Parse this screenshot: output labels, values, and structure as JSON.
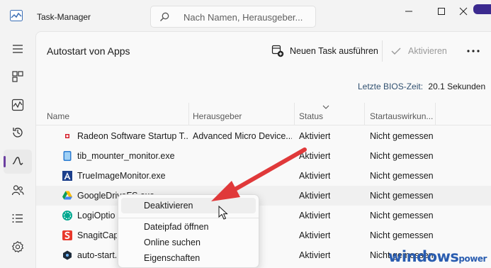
{
  "titlebar": {
    "title": "Task-Manager",
    "search_placeholder": "Nach Namen, Herausgeber..."
  },
  "nav": {
    "items": [
      {
        "icon": "hamburger-icon"
      },
      {
        "icon": "processes-icon"
      },
      {
        "icon": "performance-icon"
      },
      {
        "icon": "app-history-icon"
      },
      {
        "icon": "startup-apps-icon",
        "active": true
      },
      {
        "icon": "users-icon"
      },
      {
        "icon": "details-icon"
      },
      {
        "icon": "services-icon"
      }
    ]
  },
  "toolbar": {
    "page_title": "Autostart von Apps",
    "new_task_label": "Neuen Task ausführen",
    "disable_label": "Aktivieren"
  },
  "bios": {
    "label": "Letzte BIOS-Zeit:",
    "value": "20.1 Sekunden"
  },
  "table": {
    "columns": [
      "Name",
      "Herausgeber",
      "Status",
      "Startauswirkun..."
    ],
    "rows": [
      {
        "name": "Radeon Software Startup T...",
        "publisher": "Advanced Micro Device...",
        "status": "Aktiviert",
        "impact": "Nicht gemessen",
        "icon": "radeon-icon"
      },
      {
        "name": "tib_mounter_monitor.exe",
        "publisher": "",
        "status": "Aktiviert",
        "impact": "Nicht gemessen",
        "icon": "disk-icon"
      },
      {
        "name": "TrueImageMonitor.exe",
        "publisher": "",
        "status": "Aktiviert",
        "impact": "Nicht gemessen",
        "icon": "acronis-icon"
      },
      {
        "name": "GoogleDriveFS.exe",
        "publisher": "",
        "status": "Aktiviert",
        "impact": "Nicht gemessen",
        "icon": "google-drive-icon"
      },
      {
        "name": "LogiOptions",
        "publisher": "",
        "status": "Aktiviert",
        "impact": "Nicht gemessen",
        "icon": "logi-icon"
      },
      {
        "name": "SnagitCapture",
        "publisher": "",
        "status": "Aktiviert",
        "impact": "Nicht gemessen",
        "icon": "snagit-icon"
      },
      {
        "name": "auto-start.",
        "publisher": "",
        "status": "Aktiviert",
        "impact": "Nicht gemessen",
        "icon": "auto-start-icon"
      }
    ]
  },
  "context_menu": {
    "items": [
      "Deaktivieren",
      "Dateipfad öffnen",
      "Online suchen",
      "Eigenschaften"
    ]
  },
  "watermark": {
    "brand": "windows",
    "suffix": "power"
  },
  "colors": {
    "accent": "#6b3fa0",
    "arrow": "#e0393a",
    "watermark": "#2a5db0"
  }
}
